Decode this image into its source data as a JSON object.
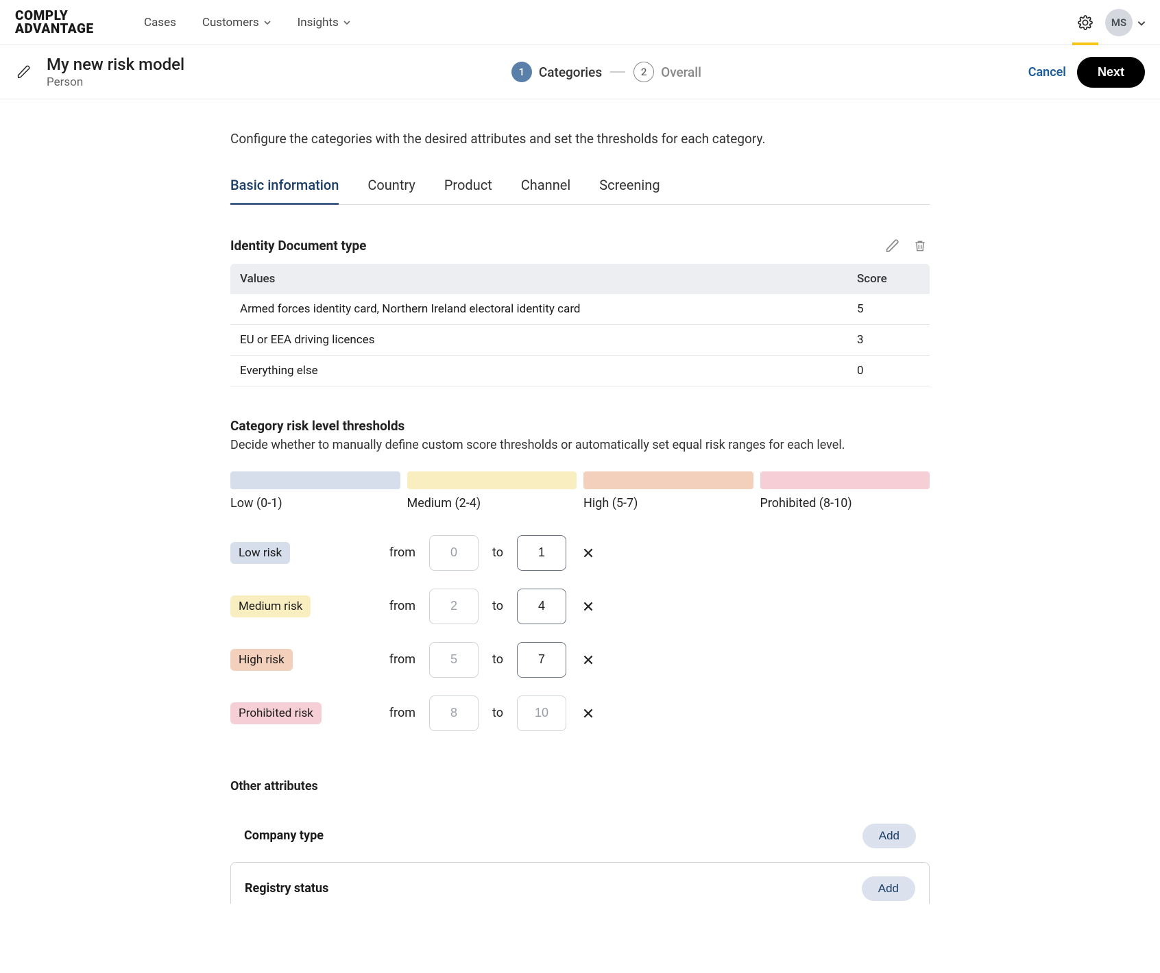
{
  "brand": {
    "line1": "COMPLY",
    "line2": "ADVANTAGE"
  },
  "nav": {
    "cases": "Cases",
    "customers": "Customers",
    "insights": "Insights"
  },
  "user": {
    "initials": "MS"
  },
  "page": {
    "title": "My new risk model",
    "subtitle": "Person"
  },
  "stepper": {
    "step1_num": "1",
    "step1_label": "Categories",
    "step2_num": "2",
    "step2_label": "Overall"
  },
  "actions": {
    "cancel": "Cancel",
    "next": "Next"
  },
  "intro": "Configure the categories with the desired attributes and set the thresholds for each category.",
  "tabs": {
    "basic": "Basic information",
    "country": "Country",
    "product": "Product",
    "channel": "Channel",
    "screening": "Screening"
  },
  "identity": {
    "title": "Identity Document type",
    "cols": {
      "values": "Values",
      "score": "Score"
    },
    "rows": [
      {
        "value": "Armed forces identity card, Northern Ireland electoral identity card",
        "score": "5"
      },
      {
        "value": "EU or EEA driving licences",
        "score": "3"
      },
      {
        "value": "Everything else",
        "score": "0"
      }
    ]
  },
  "thresholds": {
    "title": "Category risk level thresholds",
    "desc": "Decide whether to manually define custom score thresholds or automatically set equal risk ranges for each level.",
    "bars": {
      "low": "Low (0-1)",
      "medium": "Medium (2-4)",
      "high": "High (5-7)",
      "prohibited": "Prohibited (8-10)"
    },
    "labels": {
      "from": "from",
      "to": "to"
    },
    "rows": [
      {
        "chip": "Low risk",
        "chipClass": "low",
        "from": "0",
        "to": "1"
      },
      {
        "chip": "Medium risk",
        "chipClass": "med",
        "from": "2",
        "to": "4"
      },
      {
        "chip": "High risk",
        "chipClass": "high",
        "from": "5",
        "to": "7"
      },
      {
        "chip": "Prohibited risk",
        "chipClass": "proh",
        "from": "8",
        "to": "10"
      }
    ]
  },
  "other": {
    "title": "Other attributes",
    "company": "Company type",
    "registry": "Registry status",
    "add": "Add"
  }
}
